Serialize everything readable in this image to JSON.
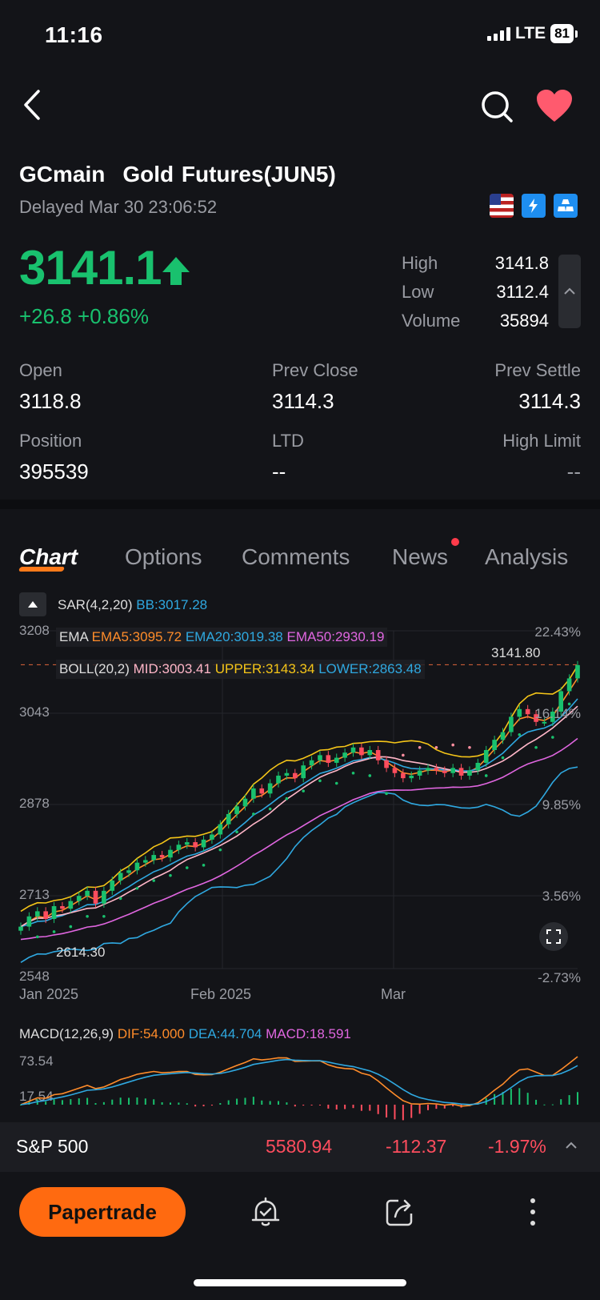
{
  "status": {
    "time": "11:16",
    "network": "LTE",
    "battery": "81"
  },
  "nav": {
    "back_icon": "chevron-left-icon",
    "search_icon": "search-icon",
    "favorite_icon": "heart-icon",
    "favorite_color": "#ff5a6e"
  },
  "header": {
    "symbol": "GCmain",
    "name": "Gold Futures(JUN5)",
    "delayed": "Delayed Mar 30 23:06:52",
    "badges": [
      "us-flag-icon",
      "fast-icon",
      "gold-bars-icon"
    ]
  },
  "quote": {
    "price": "3141.1",
    "change": "+26.8",
    "change_pct": "+0.86%",
    "up_color": "#19c16e",
    "high_label": "High",
    "high": "3141.8",
    "low_label": "Low",
    "low": "3112.4",
    "volume_label": "Volume",
    "volume": "35894"
  },
  "details": {
    "open_label": "Open",
    "open": "3118.8",
    "prev_close_label": "Prev Close",
    "prev_close": "3114.3",
    "prev_settle_label": "Prev Settle",
    "prev_settle": "3114.3",
    "position_label": "Position",
    "position": "395539",
    "ltd_label": "LTD",
    "ltd": "--",
    "high_limit_label": "High Limit",
    "high_limit": "--"
  },
  "tabs": [
    "Chart",
    "Options",
    "Comments",
    "News",
    "Analysis"
  ],
  "indicators": {
    "sar": "SAR(4,2,20)",
    "bb": "BB:3017.28",
    "ema_label": "EMA",
    "ema5": "EMA5:3095.72",
    "ema20": "EMA20:3019.38",
    "ema50": "EMA50:2930.19",
    "boll_label": "BOLL(20,2)",
    "mid": "MID:3003.41",
    "upper": "UPPER:3143.34",
    "lower": "LOWER:2863.48",
    "max_marker": "3141.80",
    "min_marker": "2614.30"
  },
  "chart_data": {
    "type": "candlestick",
    "y_ticks_left": [
      "3208",
      "3043",
      "2878",
      "2713",
      "2548"
    ],
    "y_ticks_right": [
      "22.43%",
      "16.14%",
      "9.85%",
      "3.56%",
      "-2.73%"
    ],
    "x_ticks": [
      "Jan 2025",
      "Feb 2025",
      "Mar"
    ],
    "ylim": [
      2548,
      3208
    ],
    "close": [
      2630,
      2650,
      2660,
      2645,
      2670,
      2665,
      2680,
      2690,
      2700,
      2675,
      2700,
      2720,
      2735,
      2740,
      2755,
      2760,
      2770,
      2765,
      2780,
      2790,
      2795,
      2785,
      2800,
      2810,
      2830,
      2850,
      2865,
      2880,
      2900,
      2890,
      2910,
      2925,
      2930,
      2920,
      2945,
      2955,
      2965,
      2950,
      2960,
      2970,
      2980,
      2965,
      2975,
      2955,
      2940,
      2930,
      2920,
      2925,
      2935,
      2940,
      2935,
      2930,
      2940,
      2925,
      2935,
      2950,
      2975,
      2995,
      3010,
      3040,
      3055,
      3045,
      3030,
      3030,
      3050,
      3090,
      3115,
      3141
    ],
    "series": [
      {
        "name": "EMA5",
        "color": "#ff8c2a"
      },
      {
        "name": "EMA20",
        "color": "#2fa8e0"
      },
      {
        "name": "EMA50",
        "color": "#e066e0"
      },
      {
        "name": "MID",
        "color": "#ffb6c8"
      },
      {
        "name": "UPPER",
        "color": "#f5c518"
      },
      {
        "name": "LOWER",
        "color": "#2fa8e0"
      }
    ]
  },
  "macd": {
    "label": "MACD(12,26,9)",
    "dif": "DIF:54.000",
    "dea": "DEA:44.704",
    "macd": "MACD:18.591",
    "y_ticks": [
      "73.54",
      "17.54"
    ]
  },
  "ticker": {
    "name": "S&P 500",
    "price": "5580.94",
    "change": "-112.37",
    "change_pct": "-1.97%",
    "down_color": "#ff4d5e"
  },
  "bottom": {
    "papertrade": "Papertrade",
    "icons": [
      "alert-icon",
      "share-icon",
      "more-icon"
    ]
  }
}
